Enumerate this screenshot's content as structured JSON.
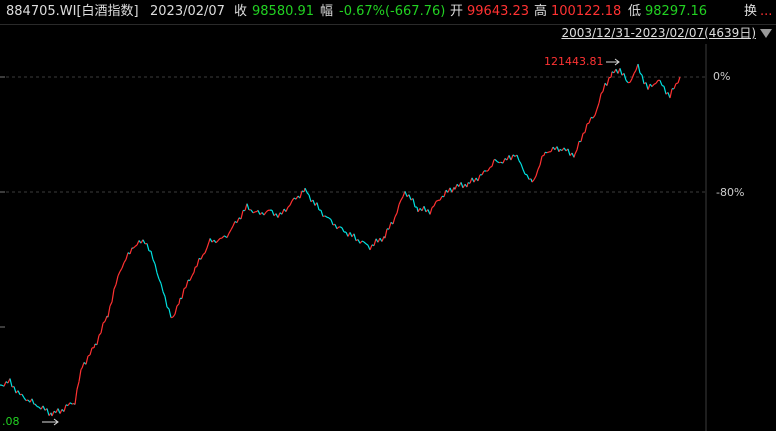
{
  "header": {
    "code": "884705.WI[白酒指数]",
    "date": "2023/02/07",
    "close_label": "收",
    "close_value": "98580.91",
    "change_label": "幅",
    "change_value": "-0.67%(-667.76)",
    "open_label": "开",
    "open_value": "99643.23",
    "high_label": "高",
    "high_value": "100122.18",
    "low_label": "低",
    "low_value": "98297.16",
    "turnover_label": "换",
    "turnover_value": "..."
  },
  "range": {
    "text": "2003/12/31-2023/02/07(4639日)"
  },
  "chart_data": {
    "type": "line",
    "y_ticks": [
      "0%",
      "-80%"
    ],
    "annotations": {
      "max_label": "121443.81",
      "min_label": ".08"
    },
    "colors": {
      "up": "#ff3232",
      "down": "#00e0e0",
      "grid": "#3b3b3b",
      "min_label": "#22d122"
    }
  }
}
